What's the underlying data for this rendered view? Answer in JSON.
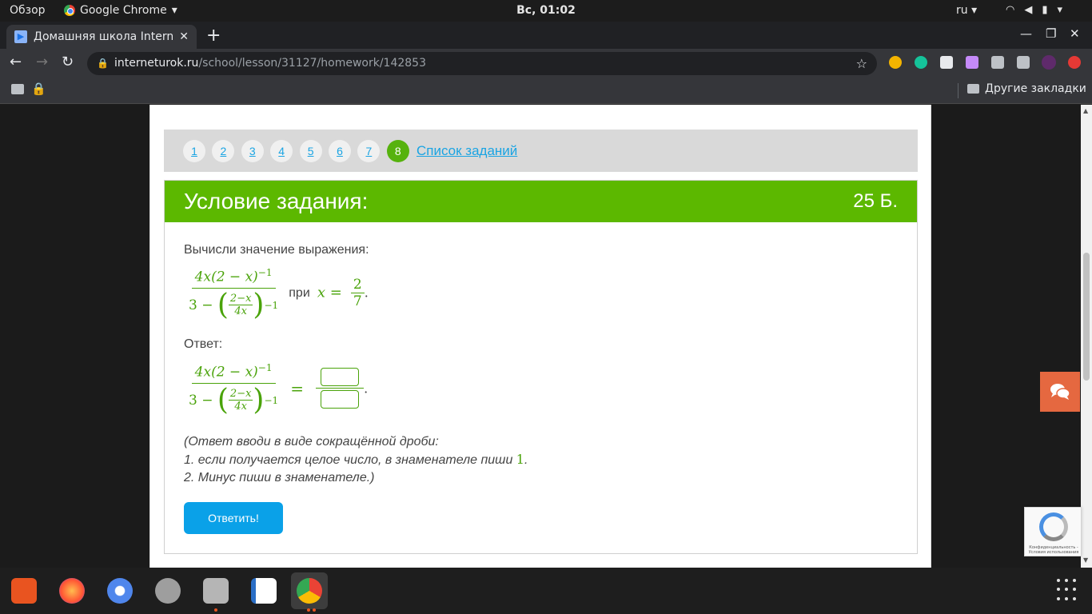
{
  "system": {
    "overview": "Обзор",
    "app_name": "Google Chrome",
    "clock": "Вс, 01:02",
    "lang": "ru"
  },
  "browser": {
    "tab_title": "Домашняя школа Interne",
    "url_host": "interneturok.ru",
    "url_path": "/school/lesson/31127/homework/142853",
    "other_bookmarks": "Другие закладки"
  },
  "task_nav": {
    "numbers": [
      "1",
      "2",
      "3",
      "4",
      "5",
      "6",
      "7",
      "8"
    ],
    "active": "8",
    "list_link": "Список заданий"
  },
  "task": {
    "heading": "Условие задания:",
    "points": "25 Б.",
    "prompt": "Вычисли значение выражения:",
    "expr_num": "4x(2 − x)",
    "exp": "−1",
    "den_lead": "3 −",
    "inner_top": "2−x",
    "inner_bottom": "4x",
    "at_word": "при",
    "var_eq": "x =",
    "x_num": "2",
    "x_den": "7",
    "dot": ".",
    "equals": "=",
    "answer_label": "Ответ:",
    "hint_line1": "(Ответ вводи в виде сокращённой дроби:",
    "hint_line2": "1. если получается целое число, в знаменателе пиши",
    "hint_one": "1",
    "hint_line3": "2. Минус пиши в знаменателе.)",
    "submit_label": "Ответить!"
  },
  "recaptcha": {
    "text": "Конфиденциальность - Условия использования"
  },
  "colors": {
    "accent_green": "#5cb800",
    "math_green": "#4aa30a",
    "link_blue": "#1aa4e3",
    "button_blue": "#0aa1e8",
    "chat_orange": "#e56840"
  }
}
